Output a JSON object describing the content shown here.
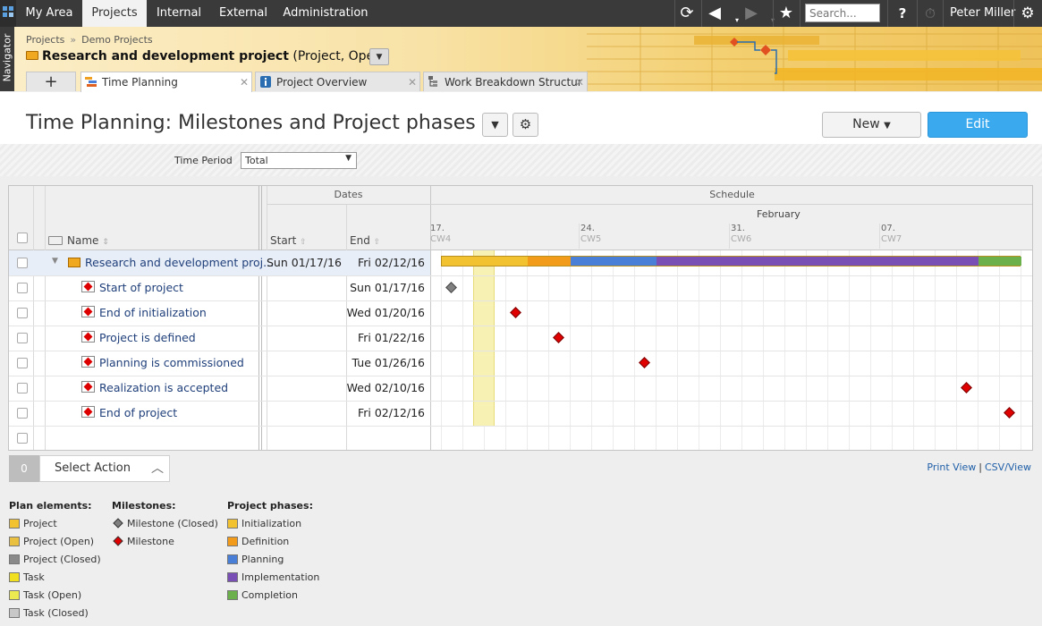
{
  "topnav": {
    "tabs": [
      "My Area",
      "Projects",
      "Internal",
      "External",
      "Administration"
    ],
    "active_tab": "Projects",
    "search_placeholder": "Search...",
    "help": "?",
    "user": "Peter Miller"
  },
  "navigator_label": "Navigator",
  "breadcrumb": [
    "Projects",
    "Demo Projects"
  ],
  "breadcrumb_sep": "»",
  "project": {
    "name": "Research and development project",
    "status": "(Project, Open)"
  },
  "tabs": [
    {
      "label": "Time Planning",
      "active": true
    },
    {
      "label": "Project Overview",
      "active": false
    },
    {
      "label": "Work Breakdown Structur",
      "active": false
    }
  ],
  "tab_add_symbol": "+",
  "page_title": "Time Planning: Milestones and Project phases",
  "buttons": {
    "new": "New",
    "edit": "Edit"
  },
  "filter": {
    "label": "Time Period",
    "value": "Total"
  },
  "grid": {
    "group_dates": "Dates",
    "group_schedule": "Schedule",
    "col_name": "Name",
    "col_start": "Start",
    "col_end": "End",
    "month": "February",
    "weeks": [
      {
        "day": "17.",
        "cw": "CW4"
      },
      {
        "day": "24.",
        "cw": "CW5"
      },
      {
        "day": "31.",
        "cw": "CW6"
      },
      {
        "day": "07.",
        "cw": "CW7"
      }
    ],
    "project_row": {
      "name": "Research and development proj...",
      "start": "Sun 01/17/16",
      "end": "Fri 02/12/16"
    },
    "milestones": [
      {
        "name": "Start of project",
        "end": "Sun 01/17/16",
        "day": 0,
        "closed": true
      },
      {
        "name": "End of initialization",
        "end": "Wed 01/20/16",
        "day": 3,
        "closed": false
      },
      {
        "name": "Project is defined",
        "end": "Fri 01/22/16",
        "day": 5,
        "closed": false
      },
      {
        "name": "Planning is commissioned",
        "end": "Tue 01/26/16",
        "day": 9,
        "closed": false
      },
      {
        "name": "Realization is accepted",
        "end": "Wed 02/10/16",
        "day": 24,
        "closed": false
      },
      {
        "name": "End of project",
        "end": "Fri 02/12/16",
        "day": 26,
        "closed": false
      }
    ],
    "phases": [
      {
        "name": "Initialization",
        "from_day": 0,
        "to_day": 4,
        "color": "#f2c230"
      },
      {
        "name": "Definition",
        "from_day": 4,
        "to_day": 6,
        "color": "#f29a1a"
      },
      {
        "name": "Planning",
        "from_day": 6,
        "to_day": 10,
        "color": "#4a7fd8"
      },
      {
        "name": "Implementation",
        "from_day": 10,
        "to_day": 25,
        "color": "#7a4fb5"
      },
      {
        "name": "Completion",
        "from_day": 25,
        "to_day": 27,
        "color": "#6cb04c"
      }
    ]
  },
  "action": {
    "count": "0",
    "label": "Select Action"
  },
  "links": {
    "print": "Print View",
    "sep": "|",
    "csv": "CSV/View"
  },
  "legend": {
    "plan_title": "Plan elements:",
    "plan": [
      {
        "label": "Project",
        "color": "#f2c230"
      },
      {
        "label": "Project (Open)",
        "color": "#e9c040"
      },
      {
        "label": "Project (Closed)",
        "color": "#8a8a8a"
      },
      {
        "label": "Task",
        "color": "#f0e020"
      },
      {
        "label": "Task (Open)",
        "color": "#ecea50"
      },
      {
        "label": "Task (Closed)",
        "color": "#c8c8c8"
      }
    ],
    "milestones_title": "Milestones:",
    "milestones": [
      {
        "label": "Milestone (Closed)",
        "color": "#808080"
      },
      {
        "label": "Milestone",
        "color": "#e00000"
      }
    ],
    "phases_title": "Project phases:",
    "phases": [
      {
        "label": "Initialization",
        "color": "#f2c230"
      },
      {
        "label": "Definition",
        "color": "#f29a1a"
      },
      {
        "label": "Planning",
        "color": "#4a7fd8"
      },
      {
        "label": "Implementation",
        "color": "#7a4fb5"
      },
      {
        "label": "Completion",
        "color": "#6cb04c"
      }
    ]
  }
}
